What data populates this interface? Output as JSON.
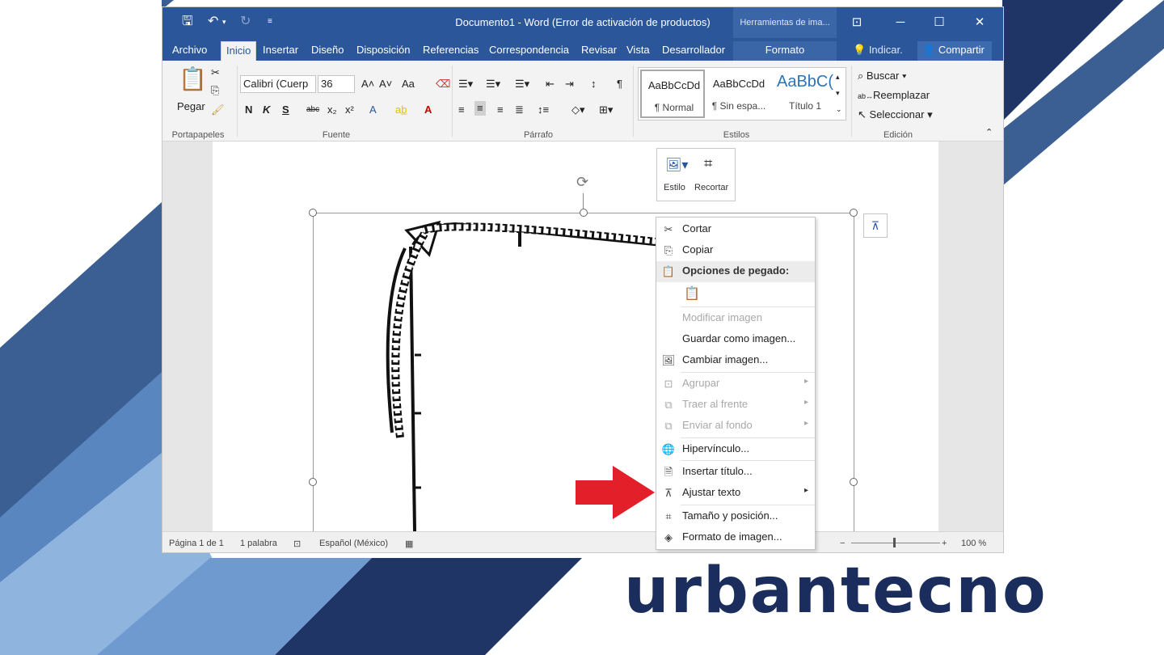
{
  "window": {
    "title": "Documento1 - Word (Error de activación de productos)",
    "context_title": "Herramientas de ima...",
    "accent_color": "#2b579a"
  },
  "tabs": [
    {
      "label": "Archivo"
    },
    {
      "label": "Inicio"
    },
    {
      "label": "Insertar"
    },
    {
      "label": "Diseño"
    },
    {
      "label": "Disposición"
    },
    {
      "label": "Referencias"
    },
    {
      "label": "Correspondencia"
    },
    {
      "label": "Revisar"
    },
    {
      "label": "Vista"
    },
    {
      "label": "Desarrollador"
    },
    {
      "label": "Formato"
    }
  ],
  "tell_me": "Indicar.",
  "share": "Compartir",
  "ribbon": {
    "clipboard": {
      "paste": "Pegar",
      "group": "Portapapeles"
    },
    "font": {
      "name": "Calibri (Cuerp",
      "size": "36",
      "case": "Aa",
      "bold": "N",
      "italic": "K",
      "underline": "S",
      "strike": "abc",
      "sub": "x₂",
      "sup": "x²",
      "group": "Fuente"
    },
    "paragraph": {
      "group": "Párrafo"
    },
    "styles": {
      "items": [
        {
          "sample": "AaBbCcDd",
          "name": "¶ Normal"
        },
        {
          "sample": "AaBbCcDd",
          "name": "¶ Sin espa..."
        },
        {
          "sample": "AaBbC(",
          "name": "Título 1"
        }
      ],
      "group": "Estilos"
    },
    "editing": {
      "find": "Buscar",
      "replace": "Reemplazar",
      "select": "Seleccionar",
      "group": "Edición"
    }
  },
  "mini_toolbar": {
    "style": "Estilo",
    "crop": "Recortar"
  },
  "context_menu": {
    "items": [
      {
        "label": "Cortar",
        "icon": "scissors-icon",
        "enabled": true
      },
      {
        "label": "Copiar",
        "icon": "copy-icon",
        "enabled": true
      },
      {
        "label": "Opciones de pegado:",
        "icon": "paste-icon",
        "header": true
      },
      {
        "label": "",
        "icon": "paste-option-icon",
        "enabled": true
      },
      {
        "label": "Modificar imagen",
        "icon": "",
        "enabled": false
      },
      {
        "label": "Guardar como imagen...",
        "icon": "",
        "enabled": true
      },
      {
        "label": "Cambiar imagen...",
        "icon": "change-picture-icon",
        "enabled": true
      },
      {
        "label": "Agrupar",
        "icon": "group-icon",
        "enabled": false,
        "submenu": true
      },
      {
        "label": "Traer al frente",
        "icon": "bring-front-icon",
        "enabled": false,
        "submenu": true
      },
      {
        "label": "Enviar al fondo",
        "icon": "send-back-icon",
        "enabled": false,
        "submenu": true
      },
      {
        "label": "Hipervínculo...",
        "icon": "hyperlink-icon",
        "enabled": true
      },
      {
        "label": "Insertar título...",
        "icon": "caption-icon",
        "enabled": true
      },
      {
        "label": "Ajustar texto",
        "icon": "wrap-text-icon",
        "enabled": true,
        "submenu": true
      },
      {
        "label": "Tamaño y posición...",
        "icon": "size-position-icon",
        "enabled": true
      },
      {
        "label": "Formato de imagen...",
        "icon": "format-picture-icon",
        "enabled": true
      }
    ]
  },
  "status": {
    "page": "Página 1 de 1",
    "words": "1 palabra",
    "language": "Español (México)",
    "zoom": "100 %"
  },
  "brand": {
    "name": "urbantecno",
    "color": "#1b2d5c"
  }
}
